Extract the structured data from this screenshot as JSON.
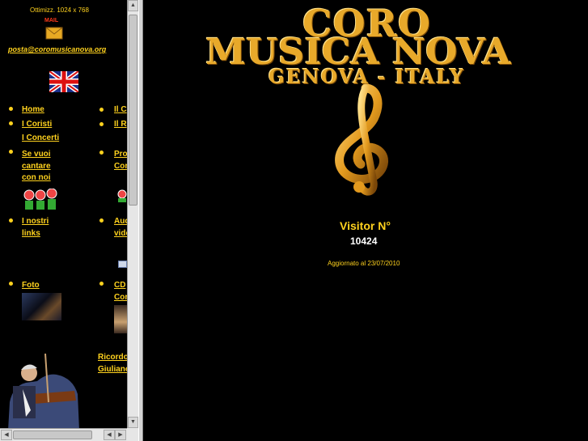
{
  "sidebar": {
    "optimized_note": "Ottimizz. 1024 x 768",
    "mail_label": "MAIL",
    "email": "posta@coromusicanova.org",
    "flag": "uk-flag-icon",
    "nav_col1": [
      "Home",
      "I Coristi",
      "I Concerti",
      "Se vuoi",
      "cantare",
      "con noi",
      "I nostri",
      "links",
      "Foto"
    ],
    "nav_col2": [
      "Il C",
      "Il R",
      "Pro",
      "Cor",
      "Aud",
      "vide",
      "CD",
      "Cor"
    ],
    "tribute": [
      "Ricordo",
      "Giuliano"
    ]
  },
  "main": {
    "logo_line1": "CORO",
    "logo_line2": "MUSICA NOVA",
    "logo_line3": "GENOVA - ITALY",
    "visitor_label": "Visitor N°",
    "visitor_count": "10424",
    "updated": "Aggiornato al 23/07/2010"
  },
  "colors": {
    "text": "#ffd21e",
    "logo": "#e8a92a",
    "background": "#000000"
  }
}
